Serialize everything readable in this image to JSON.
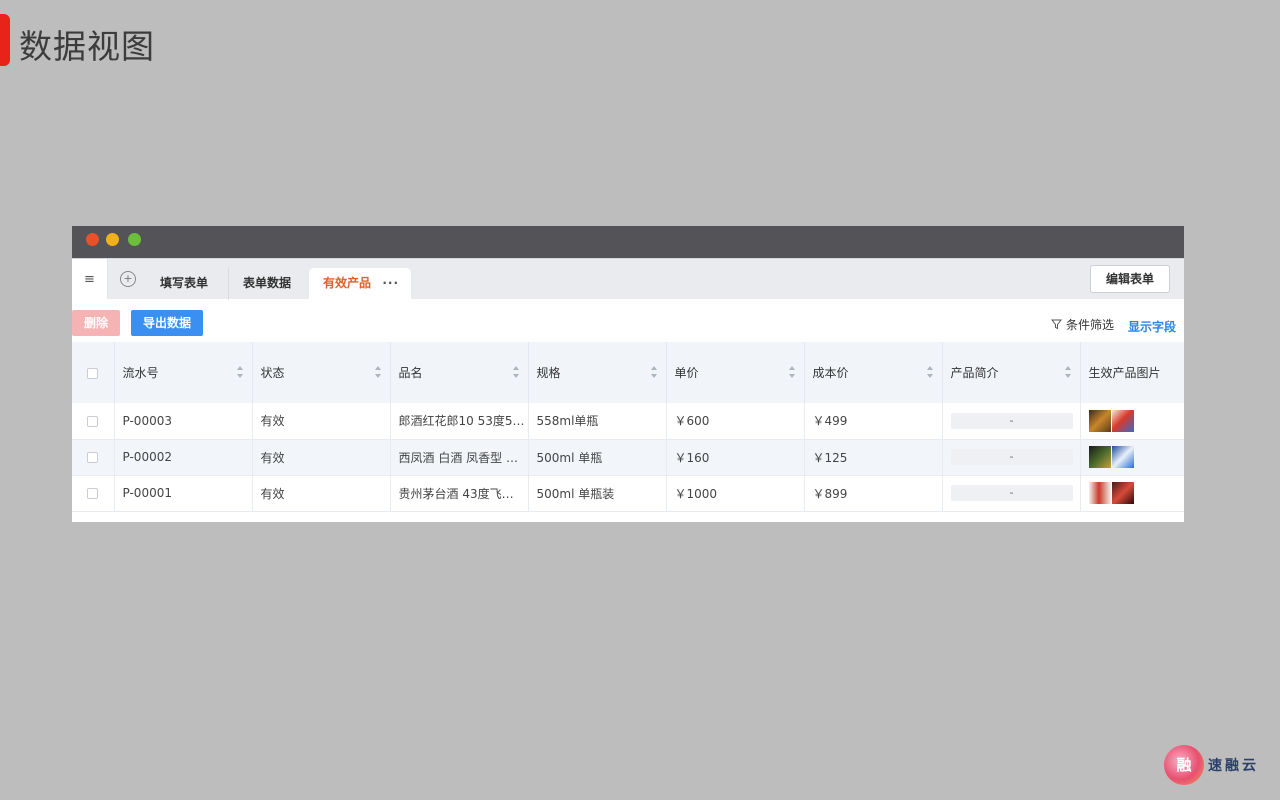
{
  "slide": {
    "title": "数据视图"
  },
  "tabs": {
    "menu_icon": "≡",
    "add_icon": "+",
    "items": [
      {
        "label": "填写表单"
      },
      {
        "label": "表单数据"
      },
      {
        "label": "有效产品"
      }
    ],
    "more_icon": "···",
    "edit_form_label": "编辑表单"
  },
  "toolbar": {
    "delete_label": "删除",
    "export_label": "导出数据",
    "filter_label": "条件筛选",
    "show_fields_label": "显示字段"
  },
  "table": {
    "columns": [
      "流水号",
      "状态",
      "品名",
      "规格",
      "单价",
      "成本价",
      "产品简介",
      "生效产品图片"
    ],
    "rows": [
      {
        "serial": "P-00003",
        "status": "有效",
        "name": "郎酒红花郎10 53度5…",
        "spec": " 558ml单瓶",
        "price": "￥600",
        "cost": "￥499",
        "intro": "-"
      },
      {
        "serial": "P-00002",
        "status": "有效",
        "name": "西凤酒 白酒 凤香型 …",
        "spec": "500ml 单瓶",
        "price": "￥160",
        "cost": "￥125",
        "intro": "-"
      },
      {
        "serial": "P-00001",
        "status": "有效",
        "name": "贵州茅台酒 43度飞…",
        "spec": "500ml 单瓶装",
        "price": "￥1000",
        "cost": "￥899",
        "intro": "-"
      }
    ]
  },
  "colors": {
    "accent_red": "#e8231a",
    "active_tab": "#e0602a",
    "primary_blue": "#3b8ff0",
    "delete_pink": "#f5b3b3"
  },
  "logo": {
    "mark": "融",
    "name": "速融云"
  }
}
